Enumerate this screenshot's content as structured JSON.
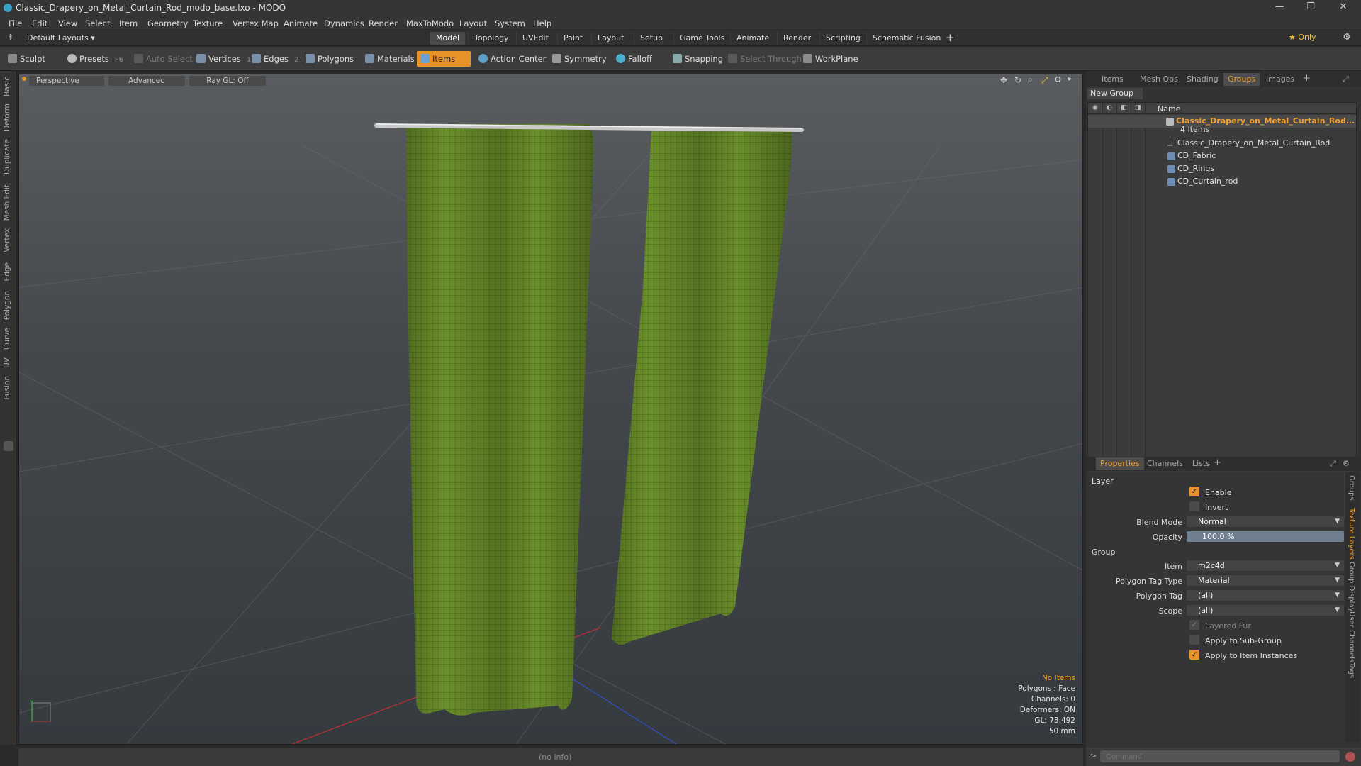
{
  "window": {
    "title": "Classic_Drapery_on_Metal_Curtain_Rod_modo_base.lxo - MODO",
    "minimize": "—",
    "restore": "❐",
    "close": "✕"
  },
  "menu": [
    "File",
    "Edit",
    "View",
    "Select",
    "Item",
    "Geometry",
    "Texture",
    "Vertex Map",
    "Animate",
    "Dynamics",
    "Render",
    "MaxToModo",
    "Layout",
    "System",
    "Help"
  ],
  "layout_selector": "Default Layouts ▾",
  "layout_tabs": [
    {
      "label": "Model",
      "active": true
    },
    {
      "label": "Topology"
    },
    {
      "label": "UVEdit"
    },
    {
      "label": "Paint"
    },
    {
      "label": "Layout"
    },
    {
      "label": "Setup"
    },
    {
      "label": "Game Tools"
    },
    {
      "label": "Animate"
    },
    {
      "label": "Render"
    },
    {
      "label": "Scripting"
    },
    {
      "label": "Schematic Fusion"
    }
  ],
  "only_label": "★ Only",
  "toolbar": {
    "sculpt": "Sculpt",
    "presets": "Presets",
    "presets_key": "F6",
    "auto_select": "Auto Select",
    "vertices": "Vertices",
    "vertices_count": "1",
    "edges": "Edges",
    "edges_count": "2",
    "polygons": "Polygons",
    "materials": "Materials",
    "items": "Items",
    "action_center": "Action Center",
    "symmetry": "Symmetry",
    "falloff": "Falloff",
    "snapping": "Snapping",
    "select_through": "Select Through",
    "workplane": "WorkPlane"
  },
  "left_tabs": [
    "Basic",
    "Deform",
    "Duplicate",
    "Mesh Edit",
    "Vertex",
    "Edge",
    "Polygon",
    "Curve",
    "UV",
    "Fusion"
  ],
  "viewport": {
    "view": "Perspective",
    "shading": "Advanced",
    "raygl": "Ray GL: Off",
    "hud": {
      "line1": "No Items",
      "line2": "Polygons : Face",
      "line3": "Channels: 0",
      "line4": "Deformers: ON",
      "line5": "GL: 73,492",
      "line6": "50 mm"
    },
    "colors": {
      "fabric": "#6a8f2a",
      "fabric_dark": "#4d6b1c",
      "rod": "#c8c8c8"
    }
  },
  "right_tabs": [
    "Items",
    "Mesh Ops",
    "Shading",
    "Groups",
    "Images"
  ],
  "right_active": "Groups",
  "new_group": "New Group",
  "tree": {
    "header": "Name",
    "group_name": "Classic_Drapery_on_Metal_Curtain_Rod...",
    "group_count": "4 Items",
    "items": [
      "Classic_Drapery_on_Metal_Curtain_Rod",
      "CD_Fabric",
      "CD_Rings",
      "CD_Curtain_rod"
    ]
  },
  "prop_tabs": [
    "Properties",
    "Channels",
    "Lists"
  ],
  "props": {
    "layer_section": "Layer",
    "enable": "Enable",
    "invert": "Invert",
    "blend_mode_label": "Blend Mode",
    "blend_mode": "Normal",
    "opacity_label": "Opacity",
    "opacity": "100.0 %",
    "group_section": "Group",
    "item_label": "Item",
    "item": "m2c4d",
    "poly_tag_type_label": "Polygon Tag Type",
    "poly_tag_type": "Material",
    "poly_tag_label": "Polygon Tag",
    "poly_tag": "(all)",
    "scope_label": "Scope",
    "scope": "(all)",
    "layered_fur": "Layered Fur",
    "apply_sub": "Apply to Sub-Group",
    "apply_inst": "Apply to Item Instances"
  },
  "right_vtabs": [
    "Groups",
    "Texture Layers",
    "Group Display",
    "User Channels",
    "Tags"
  ],
  "status": "(no info)",
  "command_placeholder": "Command"
}
